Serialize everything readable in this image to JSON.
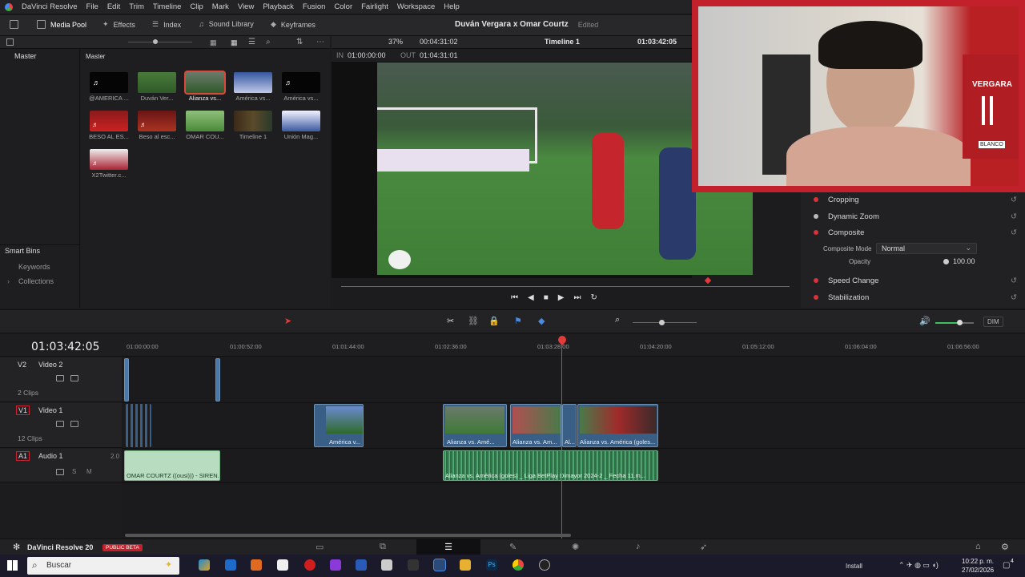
{
  "menu": [
    "DaVinci Resolve",
    "File",
    "Edit",
    "Trim",
    "Timeline",
    "Clip",
    "Mark",
    "View",
    "Playback",
    "Fusion",
    "Color",
    "Fairlight",
    "Workspace",
    "Help"
  ],
  "toolbar": {
    "media_pool": "Media Pool",
    "effects": "Effects",
    "index": "Index",
    "sound_library": "Sound Library",
    "keyframes": "Keyframes",
    "project_title": "Duván Vergara x Omar Courtz",
    "edited": "Edited"
  },
  "viewer": {
    "zoom": "37%",
    "duration": "00:04:31:02",
    "timeline_name": "Timeline 1",
    "current_tc": "01:03:42:05",
    "in_label": "IN",
    "in_tc": "01:00:00:00",
    "out_label": "OUT",
    "out_tc": "01:04:31:01"
  },
  "media_pool": {
    "bin_master": "Master",
    "header_master": "Master",
    "clips": [
      {
        "label": "@AMERICA ..."
      },
      {
        "label": "Duván Ver..."
      },
      {
        "label": "Alianza vs..."
      },
      {
        "label": "América vs..."
      },
      {
        "label": "América vs..."
      },
      {
        "label": "BESO AL ES..."
      },
      {
        "label": "Beso al esc..."
      },
      {
        "label": "OMAR COU..."
      },
      {
        "label": "Timeline 1"
      },
      {
        "label": "Unión Mag..."
      },
      {
        "label": "X2Twitter.c..."
      }
    ],
    "smart_bins": "Smart Bins",
    "keywords": "Keywords",
    "collections": "Collections"
  },
  "inspector": {
    "cropping": "Cropping",
    "dynamic_zoom": "Dynamic Zoom",
    "composite": "Composite",
    "composite_mode_label": "Composite Mode",
    "composite_mode_value": "Normal",
    "opacity_label": "Opacity",
    "opacity_value": "100.00",
    "speed_change": "Speed Change",
    "stabilization": "Stabilization"
  },
  "timeline": {
    "timecode": "01:03:42:05",
    "ruler": [
      "01:00:00:00",
      "01:00:52:00",
      "01:01:44:00",
      "01:02:36:00",
      "01:03:28:00",
      "01:04:20:00",
      "01:05:12:00",
      "01:06:04:00",
      "01:06:56:00"
    ],
    "tracks": [
      {
        "id": "V2",
        "name": "Video 2",
        "clips": "2 Clips"
      },
      {
        "id": "V1",
        "name": "Video 1",
        "clips": "12 Clips"
      },
      {
        "id": "A1",
        "name": "Audio 1",
        "level": "2.0"
      }
    ],
    "clip_labels": {
      "v1_a": "América v...",
      "v1_b": "Alianza vs. Amé...",
      "v1_c": "Alianza vs. Am...",
      "v1_d": "Al...",
      "v1_e": "Alianza vs. América (goles...",
      "a1_a": "OMAR COURTZ ((ousi))) - SIREN...",
      "a1_b": "Alianza vs. América (goles) _ Liga BetPlay Dimayor 2024-2 _ Fecha 11.m..."
    },
    "audio_level_volume": "DIM"
  },
  "footer": {
    "app_name": "DaVinci Resolve 20",
    "badge": "PUBLIC BETA"
  },
  "taskbar": {
    "search": "Buscar",
    "install": "Install",
    "time": "10:22 p. m.",
    "date": "27/02/2026",
    "notif_count": "4"
  },
  "webcam": {
    "poster_text": "VERGARA",
    "shirt_text": "BLANCO"
  },
  "colors": {
    "accent_red": "#d8333a",
    "clip_blue": "#3a5f86",
    "audio_green": "#3c8a5a",
    "playhead": "#e23b3b"
  }
}
